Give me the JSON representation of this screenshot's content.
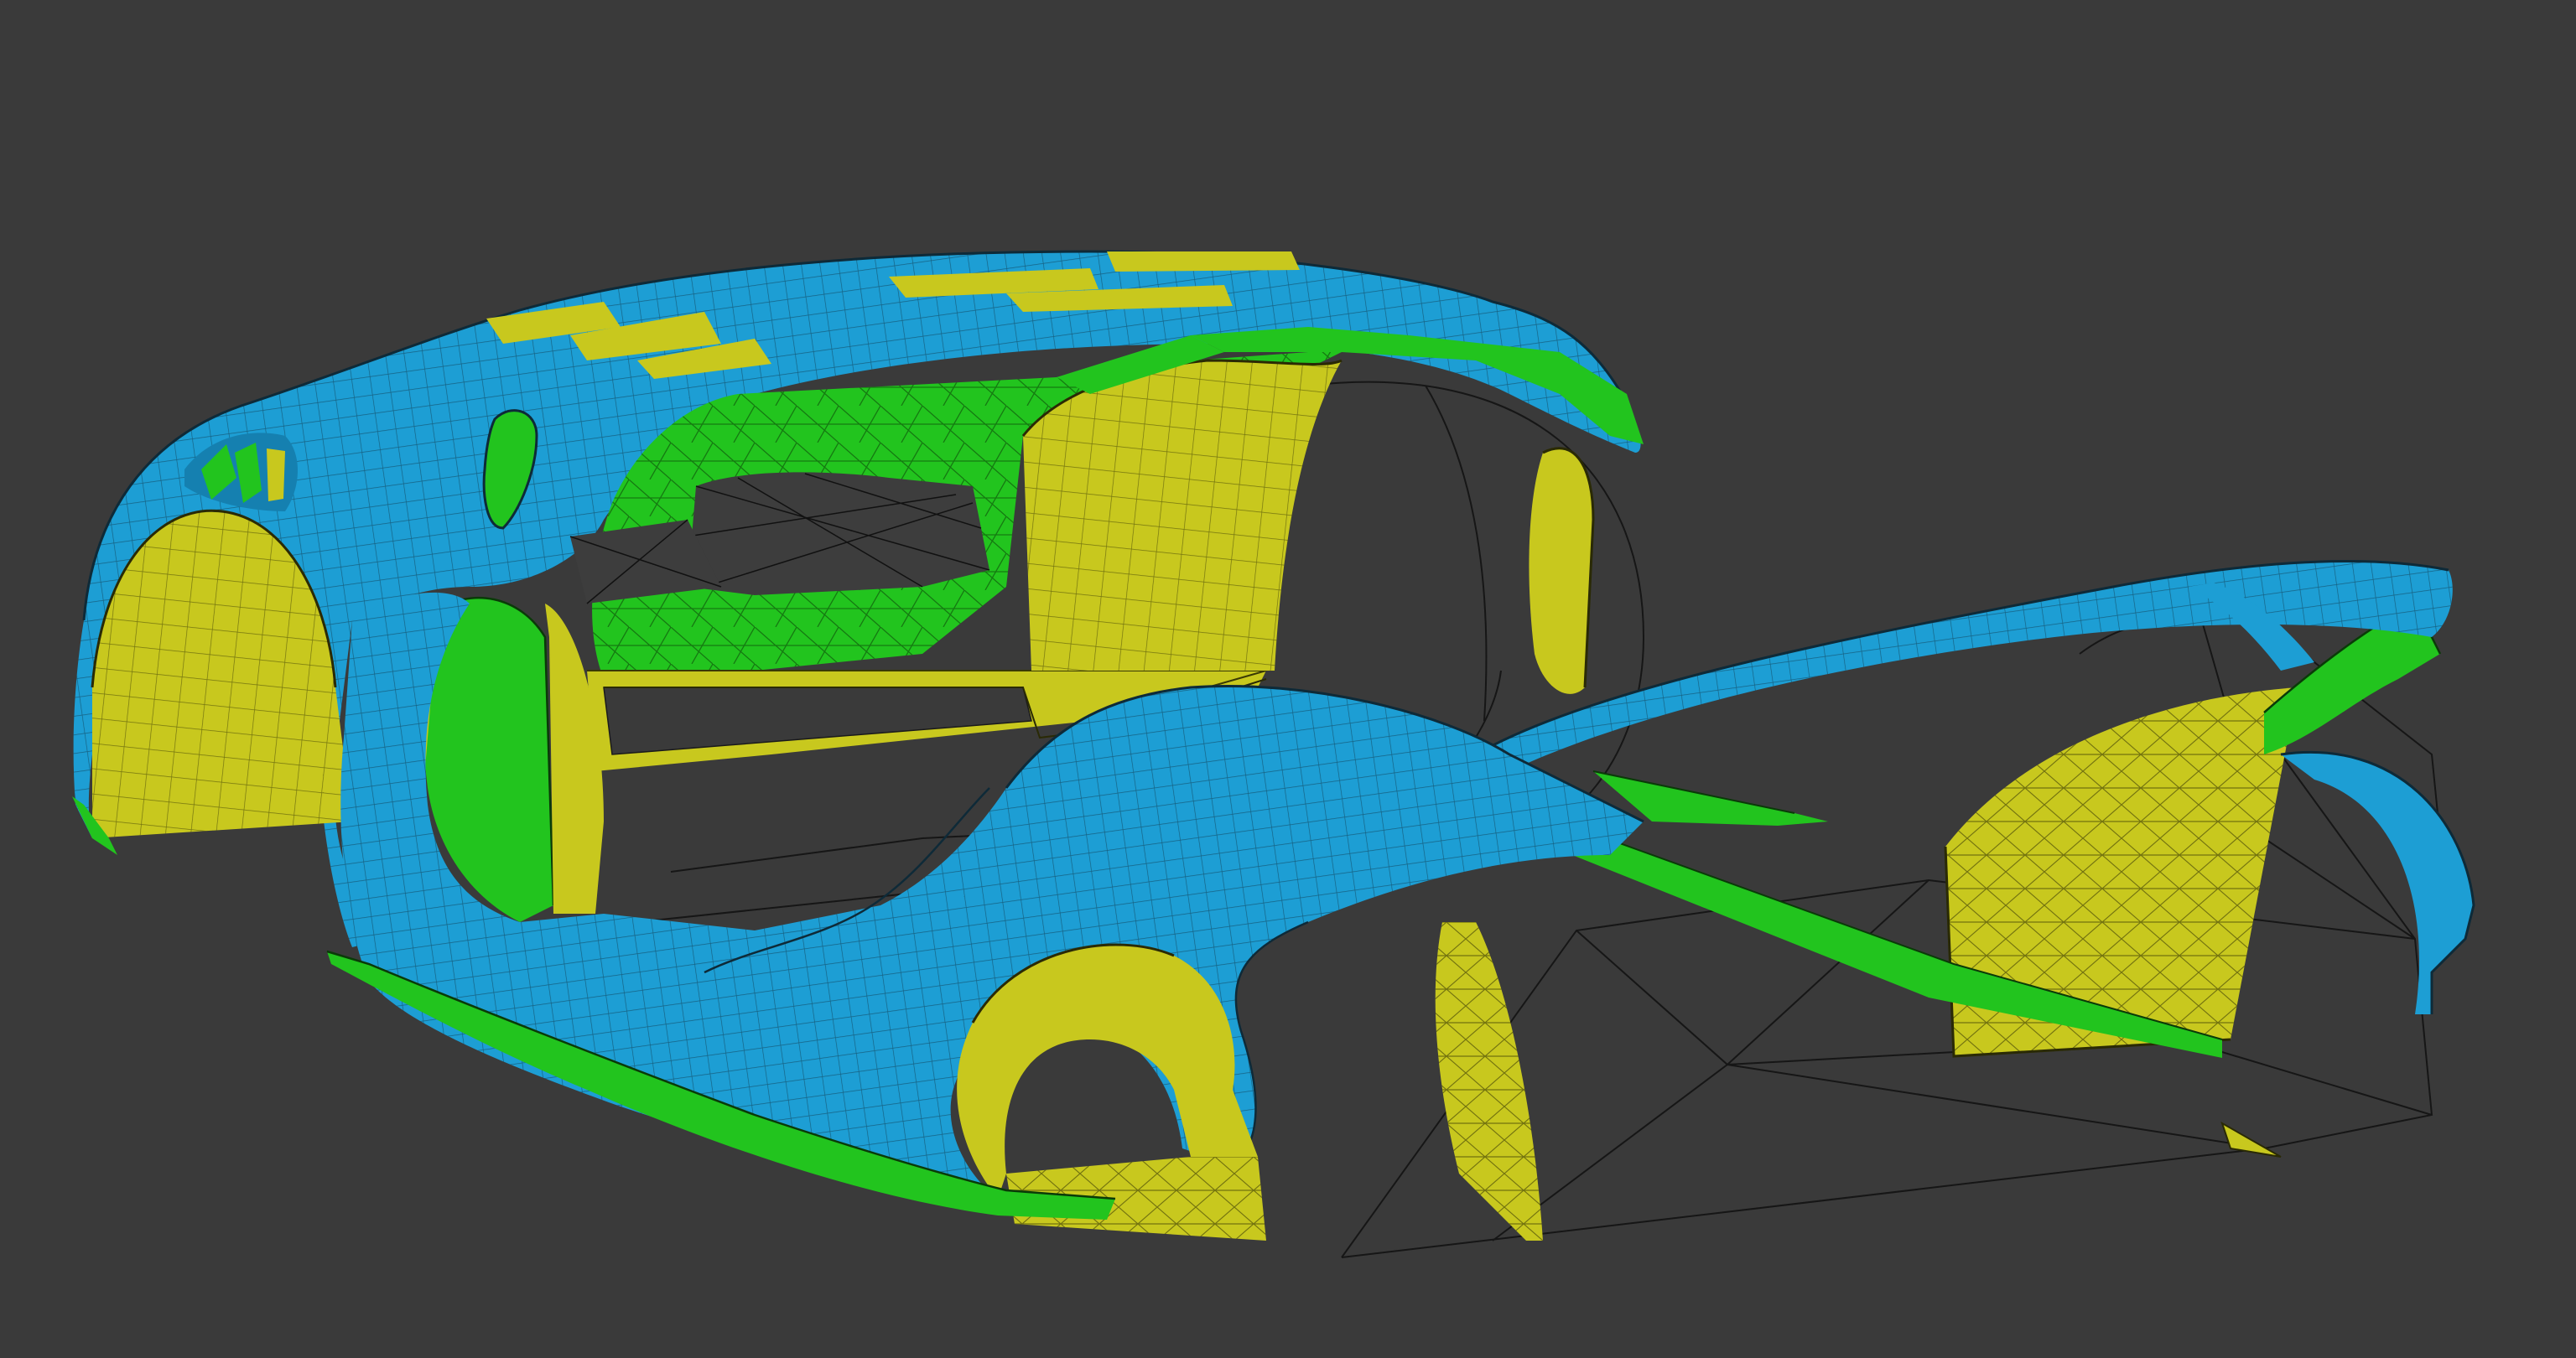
{
  "viewport": {
    "background": "#3a3a3a",
    "wire": "#1c1c1c",
    "ghost_wire": "#151515"
  },
  "materials": {
    "body_panel": "#1d9ed4",
    "body_panel_dark": "#1580b0",
    "inner_liner": "#c8c81e",
    "inner_liner_dark": "#a8a814",
    "structure": "#22c41e",
    "structure_dark": "#189a14"
  },
  "scene": {
    "object": "car-body-wireframe-model"
  }
}
